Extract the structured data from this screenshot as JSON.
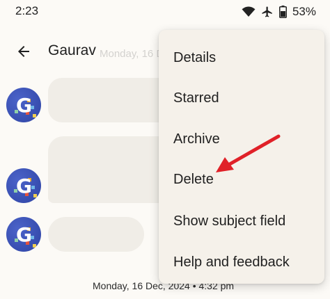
{
  "status_bar": {
    "time": "2:23",
    "battery_percent": "53%",
    "icons": [
      "wifi-icon",
      "airplane-mode-icon",
      "battery-icon"
    ]
  },
  "conversation": {
    "contact_name": "Gaurav",
    "avatar_letter": "G",
    "date_header_partial": "Monday, 16 Dec",
    "date_label": "Monday, 16 Dec, 2024 • 4:32 pm"
  },
  "overflow_menu": {
    "items": [
      {
        "label": "Details"
      },
      {
        "label": "Starred"
      },
      {
        "label": "Archive"
      },
      {
        "label": "Delete"
      },
      {
        "label": "Show subject field"
      },
      {
        "label": "Help and feedback"
      }
    ]
  },
  "annotation": {
    "arrow_color": "#e02128",
    "points_to": "Delete"
  },
  "colors": {
    "background": "#fcfaf6",
    "menu_surface": "#f5f1ea",
    "bubble": "#f0ede7",
    "avatar": "#3a52b8"
  }
}
